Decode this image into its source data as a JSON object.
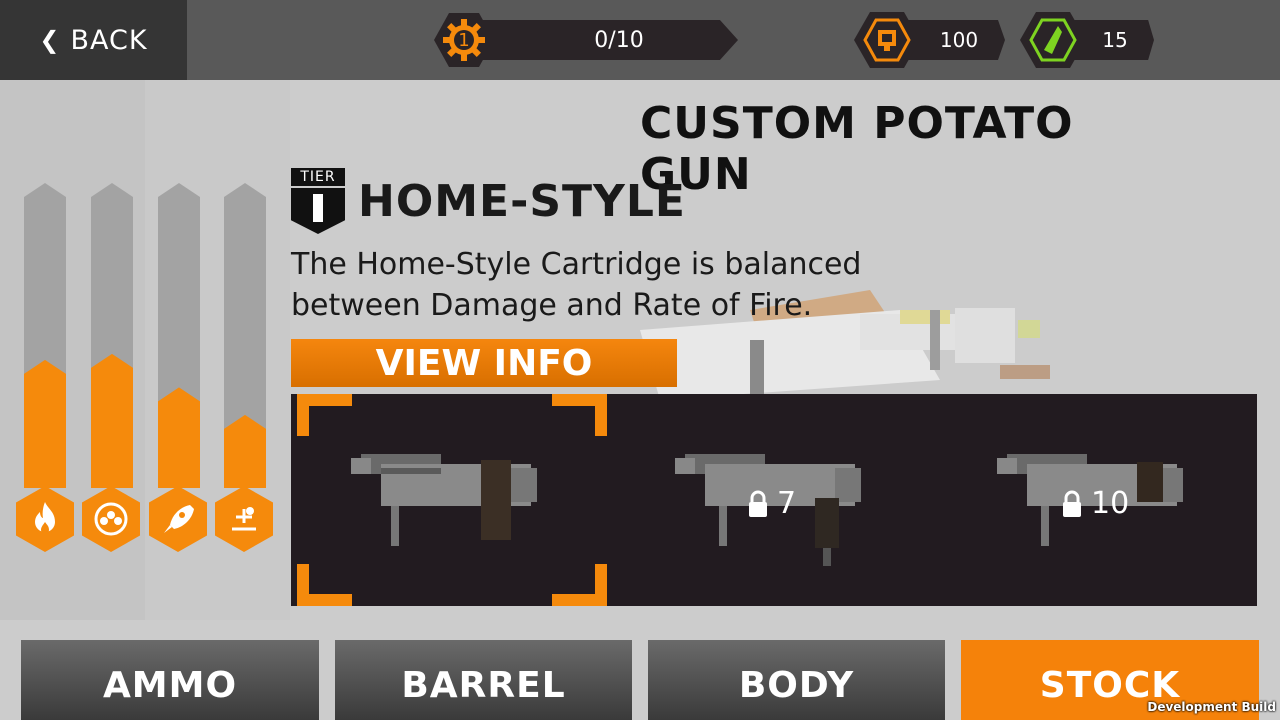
{
  "topbar": {
    "back_label": "BACK",
    "level_number": "1",
    "progress_text": "0/10",
    "coins_value": "100",
    "gems_value": "15"
  },
  "header": {
    "title": "CUSTOM POTATO GUN",
    "tier_label": "TIER",
    "part_name": "HOME-STYLE",
    "description": "The Home-Style Cartridge is balanced between Damage and Rate of Fire.",
    "view_info_label": "VIEW INFO"
  },
  "stats": [
    {
      "name": "damage",
      "icon": "fire-icon",
      "fill": 0.42
    },
    {
      "name": "ammo",
      "icon": "ammo-cluster-icon",
      "fill": 0.44
    },
    {
      "name": "speed",
      "icon": "rocket-icon",
      "fill": 0.33
    },
    {
      "name": "range",
      "icon": "target-icon",
      "fill": 0.24
    }
  ],
  "parts": [
    {
      "name": "cartridge-1",
      "locked": false,
      "selected": true,
      "unlock_level": ""
    },
    {
      "name": "cartridge-2",
      "locked": true,
      "selected": false,
      "unlock_level": "7"
    },
    {
      "name": "cartridge-3",
      "locked": true,
      "selected": false,
      "unlock_level": "10"
    }
  ],
  "tabs": [
    {
      "label": "AMMO",
      "active": false
    },
    {
      "label": "BARREL",
      "active": false
    },
    {
      "label": "BODY",
      "active": false
    },
    {
      "label": "STOCK",
      "active": true
    }
  ],
  "footer": {
    "dev_build": "Development Build"
  },
  "colors": {
    "accent": "#f58a0c",
    "panel": "#221b20",
    "gem": "#7ed321"
  }
}
